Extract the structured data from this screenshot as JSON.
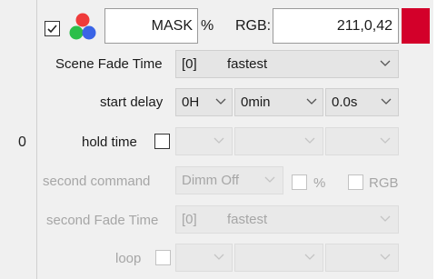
{
  "row": {
    "index": "0"
  },
  "top": {
    "mask_checked": true,
    "mask_value": "MASK",
    "percent_symbol": "%",
    "rgb_label": "RGB:",
    "rgb_value": "211,0,42",
    "swatch_color": "#d3002a",
    "icon": "rgb-circles-icon"
  },
  "scene_fade": {
    "label": "Scene Fade Time",
    "index": "[0]",
    "value": "fastest"
  },
  "start_delay": {
    "label": "start delay",
    "hours": "0H",
    "minutes": "0min",
    "seconds": "0.0s"
  },
  "hold_time": {
    "label": "hold time",
    "checked": false
  },
  "second_command": {
    "label": "second command",
    "value": "Dimm Off",
    "percent_label": "%",
    "rgb_label": "RGB"
  },
  "second_fade": {
    "label": "second Fade Time",
    "index": "[0]",
    "value": "fastest"
  },
  "loop": {
    "label": "loop",
    "checked": false
  }
}
